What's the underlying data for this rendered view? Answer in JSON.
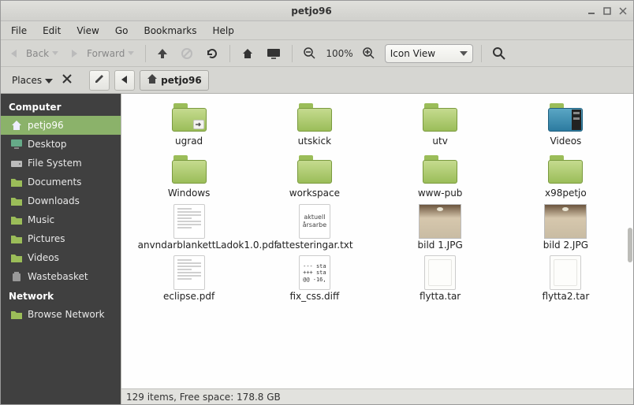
{
  "window": {
    "title": "petjo96"
  },
  "menubar": [
    "File",
    "Edit",
    "View",
    "Go",
    "Bookmarks",
    "Help"
  ],
  "toolbar": {
    "back_label": "Back",
    "forward_label": "Forward",
    "zoom_label": "100%",
    "view_mode": "Icon View"
  },
  "pathbar": {
    "places_label": "Places",
    "segment": "petjo96"
  },
  "sidebar": {
    "computer_header": "Computer",
    "network_header": "Network",
    "items_computer": [
      {
        "label": "petjo96",
        "icon": "home",
        "active": true
      },
      {
        "label": "Desktop",
        "icon": "desktop",
        "active": false
      },
      {
        "label": "File System",
        "icon": "drive",
        "active": false
      },
      {
        "label": "Documents",
        "icon": "folder",
        "active": false
      },
      {
        "label": "Downloads",
        "icon": "folder",
        "active": false
      },
      {
        "label": "Music",
        "icon": "folder",
        "active": false
      },
      {
        "label": "Pictures",
        "icon": "folder",
        "active": false
      },
      {
        "label": "Videos",
        "icon": "folder",
        "active": false
      },
      {
        "label": "Wastebasket",
        "icon": "trash",
        "active": false
      }
    ],
    "items_network": [
      {
        "label": "Browse Network",
        "icon": "folder",
        "active": false
      }
    ]
  },
  "files": [
    {
      "name": "ugrad",
      "type": "folder-link"
    },
    {
      "name": "utskick",
      "type": "folder"
    },
    {
      "name": "utv",
      "type": "folder"
    },
    {
      "name": "Videos",
      "type": "folder-videos"
    },
    {
      "name": "Windows",
      "type": "folder"
    },
    {
      "name": "workspace",
      "type": "folder"
    },
    {
      "name": "www-pub",
      "type": "folder"
    },
    {
      "name": "x98petjo",
      "type": "folder"
    },
    {
      "name": "anvndarblankettLadok1.0.pdf",
      "type": "pdf"
    },
    {
      "name": "attesteringar.txt",
      "type": "txt",
      "preview": "aktuell\nårsarbe"
    },
    {
      "name": "bild 1.JPG",
      "type": "image"
    },
    {
      "name": "bild 2.JPG",
      "type": "image"
    },
    {
      "name": "eclipse.pdf",
      "type": "pdf"
    },
    {
      "name": "fix_css.diff",
      "type": "diff",
      "preview": "--- sta\n+++ sta\n@@ -16,"
    },
    {
      "name": "flytta.tar",
      "type": "tar"
    },
    {
      "name": "flytta2.tar",
      "type": "tar"
    }
  ],
  "status": "129 items, Free space: 178.8 GB"
}
